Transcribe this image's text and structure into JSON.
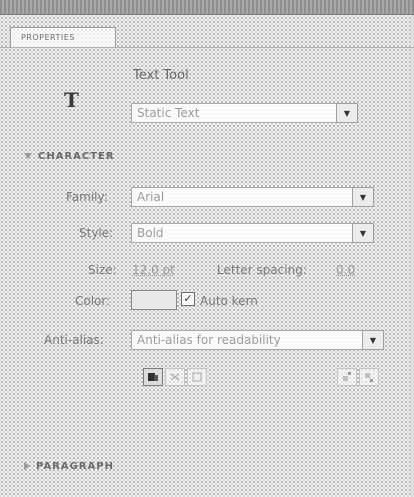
{
  "panel": {
    "tab_label": "PROPERTIES"
  },
  "tool": {
    "icon_glyph": "T",
    "title": "Text Tool",
    "text_type": "Static Text"
  },
  "character": {
    "section_label": "CHARACTER",
    "family_label": "Family:",
    "family_value": "Arial",
    "style_label": "Style:",
    "style_value": "Bold",
    "size_label": "Size:",
    "size_value": "12.0 pt",
    "letter_spacing_label": "Letter spacing:",
    "letter_spacing_value": "0.0",
    "color_label": "Color:",
    "auto_kern_label": "Auto kern",
    "auto_kern_checked": true,
    "anti_alias_label": "Anti-alias:",
    "anti_alias_value": "Anti-alias for readability"
  },
  "paragraph": {
    "section_label": "PARAGRAPH"
  },
  "icons": {
    "dropdown": "triangle-down-icon",
    "checkmark": "check-icon",
    "selectable": "selectable-text-icon",
    "render_html": "render-html-icon",
    "border": "show-border-icon",
    "superscript": "superscript-icon",
    "subscript": "subscript-icon"
  }
}
